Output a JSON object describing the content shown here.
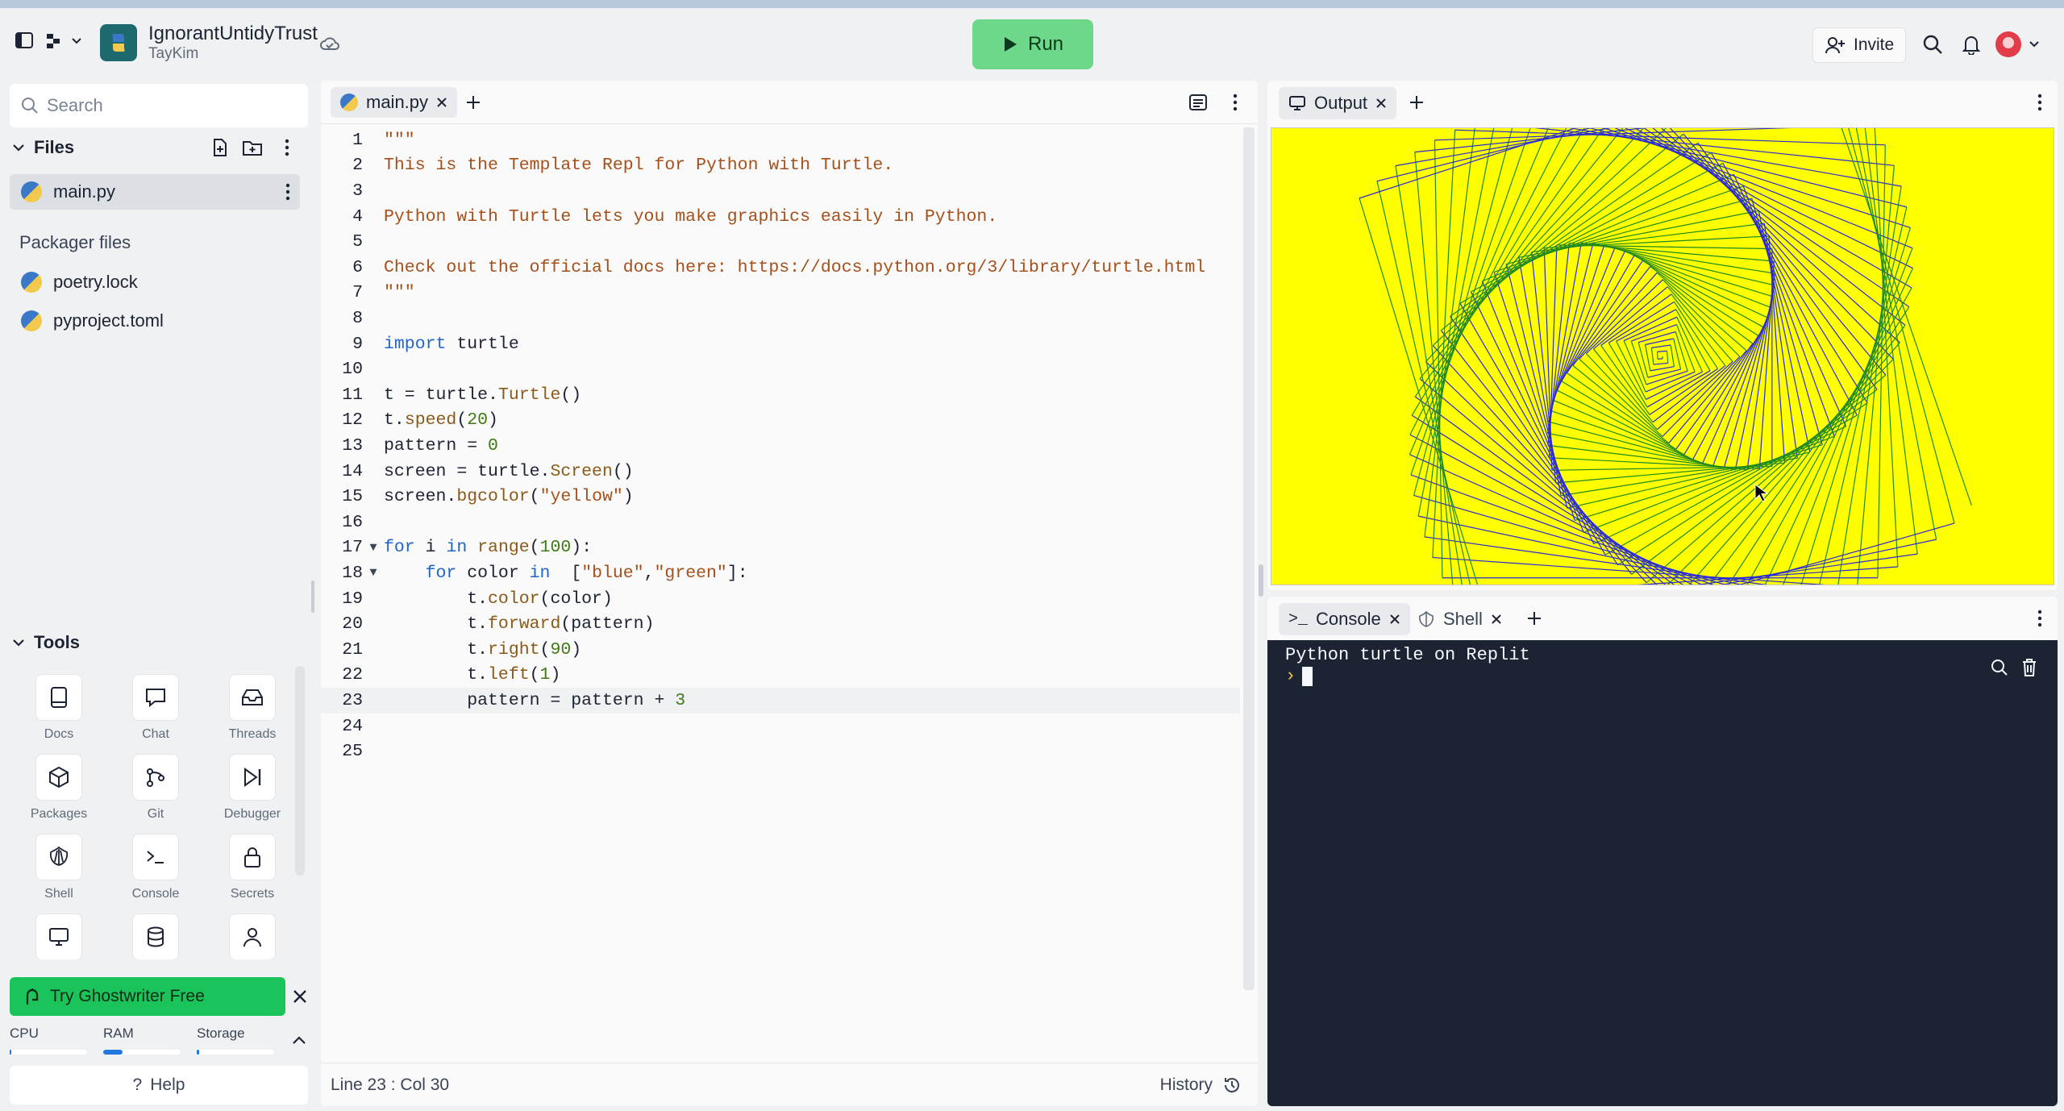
{
  "header": {
    "repl_name": "IgnorantUntidyTrust",
    "username": "TayKim",
    "run_label": "Run",
    "invite_label": "Invite"
  },
  "sidebar": {
    "search_placeholder": "Search",
    "files_heading": "Files",
    "files": [
      {
        "name": "main.py",
        "active": true
      }
    ],
    "packager_heading": "Packager files",
    "packager_files": [
      {
        "name": "poetry.lock"
      },
      {
        "name": "pyproject.toml"
      }
    ],
    "tools_heading": "Tools",
    "tools": [
      {
        "label": "Docs",
        "icon": "docs-icon"
      },
      {
        "label": "Chat",
        "icon": "chat-icon"
      },
      {
        "label": "Threads",
        "icon": "threads-icon"
      },
      {
        "label": "Packages",
        "icon": "packages-icon"
      },
      {
        "label": "Git",
        "icon": "git-icon"
      },
      {
        "label": "Debugger",
        "icon": "debugger-icon"
      },
      {
        "label": "Shell",
        "icon": "shell-icon"
      },
      {
        "label": "Console",
        "icon": "console-icon"
      },
      {
        "label": "Secrets",
        "icon": "secrets-icon"
      }
    ],
    "ghostwriter_label": "Try Ghostwriter Free",
    "resources": {
      "cpu_label": "CPU",
      "ram_label": "RAM",
      "storage_label": "Storage",
      "cpu_usage": 0.02,
      "ram_usage": 0.25,
      "storage_usage": 0.03
    },
    "help_label": "Help"
  },
  "editor": {
    "tab_name": "main.py",
    "status_position": "Line 23 : Col 30",
    "history_label": "History",
    "current_line": 23,
    "lines": [
      "\"\"\"",
      "This is the Template Repl for Python with Turtle.",
      "",
      "Python with Turtle lets you make graphics easily in Python.",
      "",
      "Check out the official docs here: https://docs.python.org/3/library/turtle.html",
      "\"\"\"",
      "",
      "import turtle",
      "",
      "t = turtle.Turtle()",
      "t.speed(20)",
      "pattern = 0",
      "screen = turtle.Screen()",
      "screen.bgcolor(\"yellow\")",
      "",
      "for i in range(100):",
      "    for color in  [\"blue\",\"green\"]:",
      "        t.color(color)",
      "        t.forward(pattern)",
      "        t.right(90)",
      "        t.left(1)",
      "        pattern = pattern + 3",
      "",
      ""
    ]
  },
  "output": {
    "tab_name": "Output",
    "bgcolor": "#ffff00"
  },
  "console": {
    "tabs": [
      "Console",
      "Shell"
    ],
    "output_text": "Python turtle on Replit",
    "prompt": "›"
  }
}
